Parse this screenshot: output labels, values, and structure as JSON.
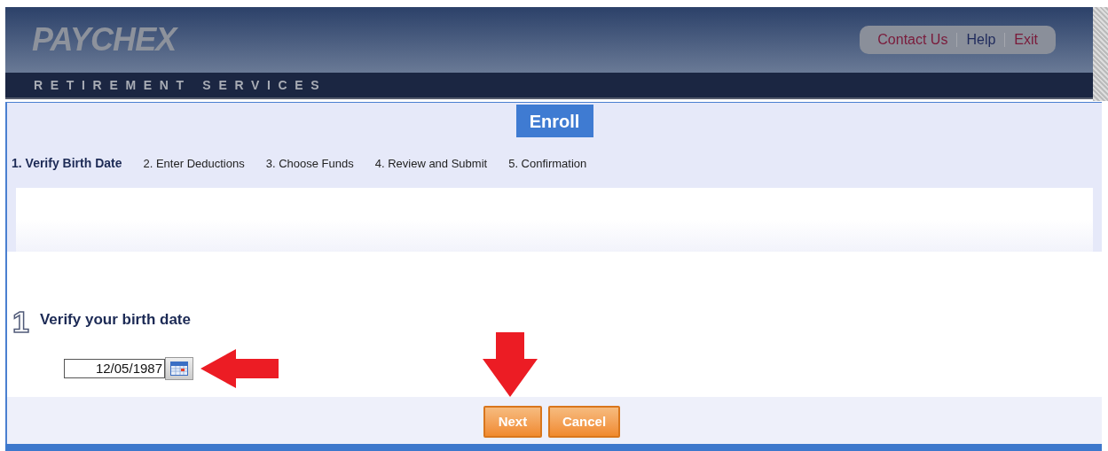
{
  "header": {
    "logo": "PAYCHEX",
    "subtitle": "RETIREMENT SERVICES",
    "links": [
      {
        "label": "Contact Us",
        "kind": "accent"
      },
      {
        "label": "Help",
        "kind": "plain"
      },
      {
        "label": "Exit",
        "kind": "accent"
      }
    ]
  },
  "title_tab": "Enroll",
  "steps": [
    {
      "label": "1. Verify Birth Date",
      "selected": true
    },
    {
      "label": "2. Enter Deductions",
      "selected": false
    },
    {
      "label": "3. Choose Funds",
      "selected": false
    },
    {
      "label": "4. Review and Submit",
      "selected": false
    },
    {
      "label": "5. Confirmation",
      "selected": false
    }
  ],
  "section": {
    "number": "1",
    "heading": "Verify your birth date",
    "birth_date": "12/05/1987"
  },
  "buttons": [
    {
      "label": "Next"
    },
    {
      "label": "Cancel"
    }
  ]
}
